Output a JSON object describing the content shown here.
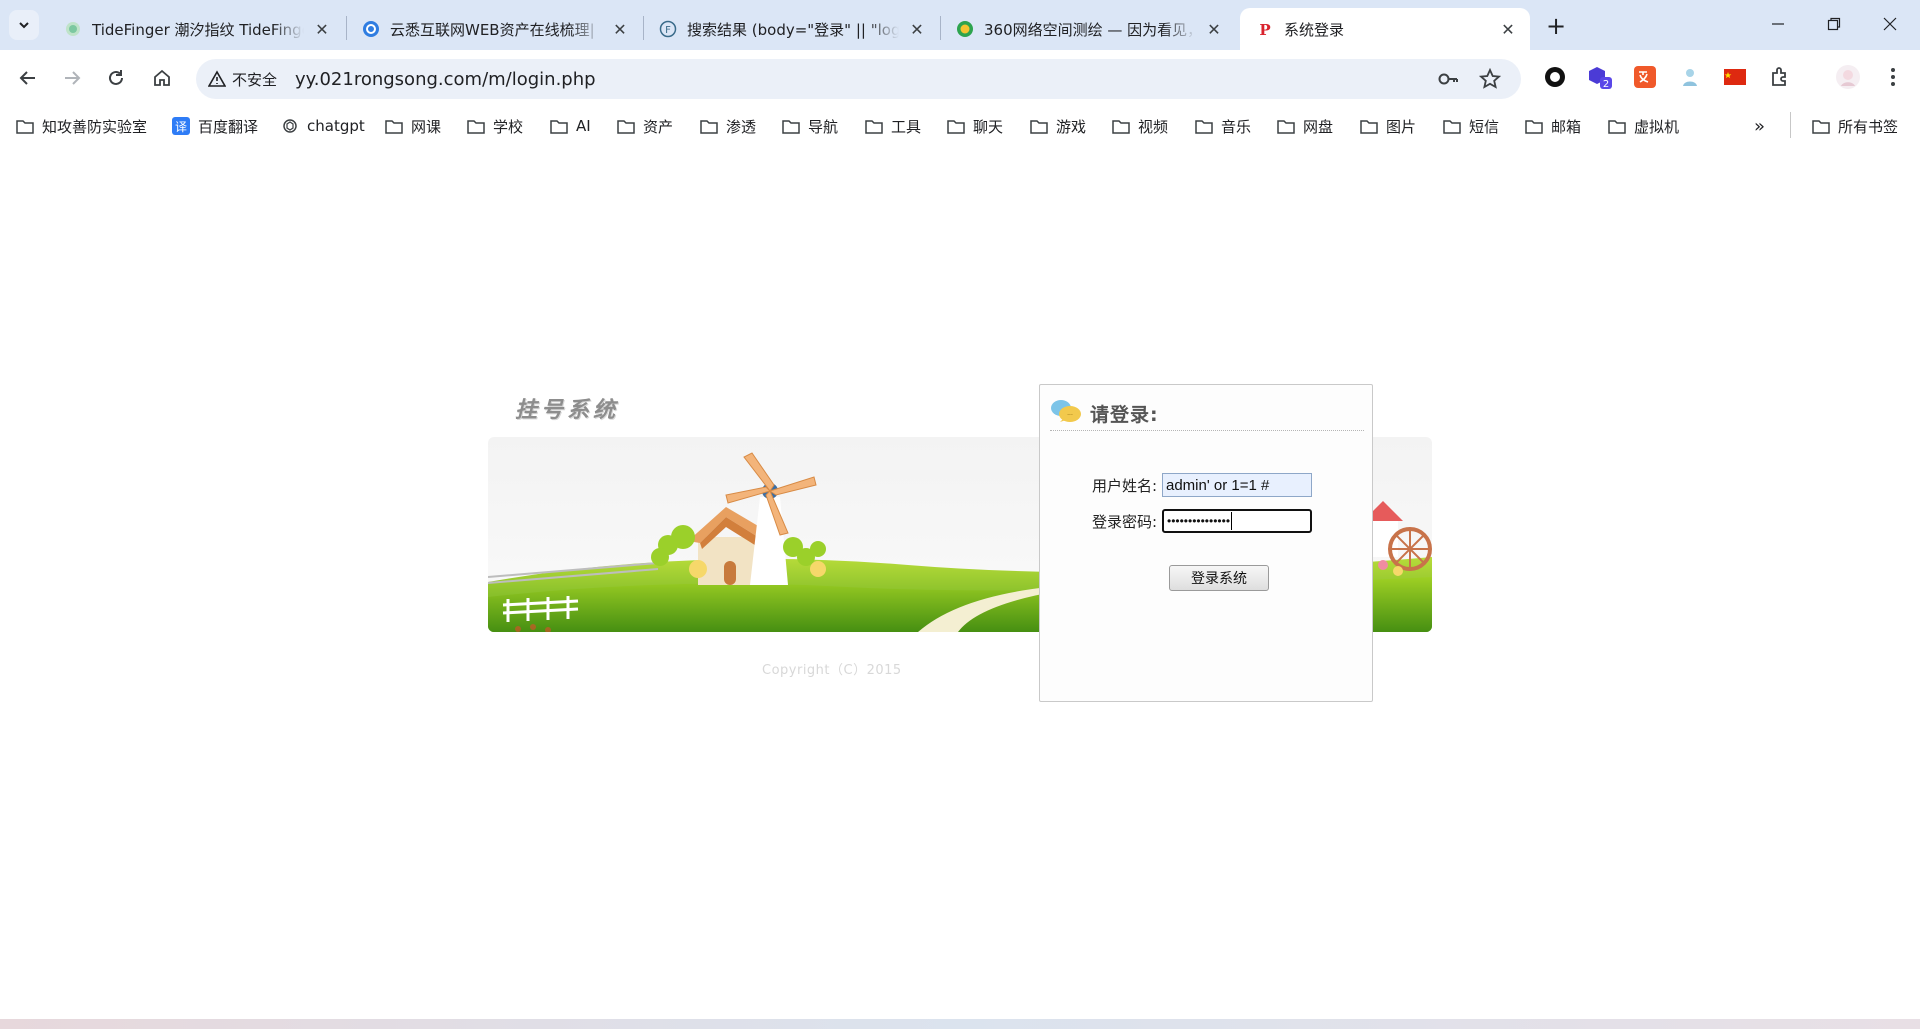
{
  "browser": {
    "tabs": [
      {
        "title": "TideFinger 潮汐指纹 TideFinger",
        "icon": "tidefinger-icon"
      },
      {
        "title": "云悉互联网WEB资产在线梳理|",
        "icon": "yunxi-icon"
      },
      {
        "title": "搜索结果 (body=\"登录\" || \"log",
        "icon": "fofa-icon"
      },
      {
        "title": "360网络空间测绘 — 因为看见，",
        "icon": "quake360-icon"
      },
      {
        "title": "系统登录",
        "icon": "p-logo-icon"
      }
    ],
    "security_label": "不安全",
    "url": "yy.021rongsong.com/m/login.php",
    "extension_badge": "2",
    "bookmarks": [
      {
        "label": "知攻善防实验室",
        "icon": "folder-icon"
      },
      {
        "label": "百度翻译",
        "icon": "translate-icon",
        "icon_text": "译"
      },
      {
        "label": "chatgpt",
        "icon": "chatgpt-icon"
      },
      {
        "label": "网课",
        "icon": "folder-icon"
      },
      {
        "label": "学校",
        "icon": "folder-icon"
      },
      {
        "label": "AI",
        "icon": "folder-icon"
      },
      {
        "label": "资产",
        "icon": "folder-icon"
      },
      {
        "label": "渗透",
        "icon": "folder-icon"
      },
      {
        "label": "导航",
        "icon": "folder-icon"
      },
      {
        "label": "工具",
        "icon": "folder-icon"
      },
      {
        "label": "聊天",
        "icon": "folder-icon"
      },
      {
        "label": "游戏",
        "icon": "folder-icon"
      },
      {
        "label": "视频",
        "icon": "folder-icon"
      },
      {
        "label": "音乐",
        "icon": "folder-icon"
      },
      {
        "label": "网盘",
        "icon": "folder-icon"
      },
      {
        "label": "图片",
        "icon": "folder-icon"
      },
      {
        "label": "短信",
        "icon": "folder-icon"
      },
      {
        "label": "邮箱",
        "icon": "folder-icon"
      },
      {
        "label": "虚拟机",
        "icon": "folder-icon"
      }
    ],
    "all_bookmarks_label": "所有书签",
    "colors": {
      "tabstrip": "#dbe6f6",
      "omnibox": "#ebf0f8",
      "accent": "#1a73e8"
    }
  },
  "page": {
    "brand": "挂号系统",
    "copyright": "Copyright（C）2015",
    "login": {
      "heading": "请登录:",
      "username_label": "用户姓名:",
      "username_value": "admin' or 1=1 #",
      "password_label": "登录密码:",
      "password_mask": "•••••••••••••••",
      "submit_label": "登录系统"
    }
  }
}
